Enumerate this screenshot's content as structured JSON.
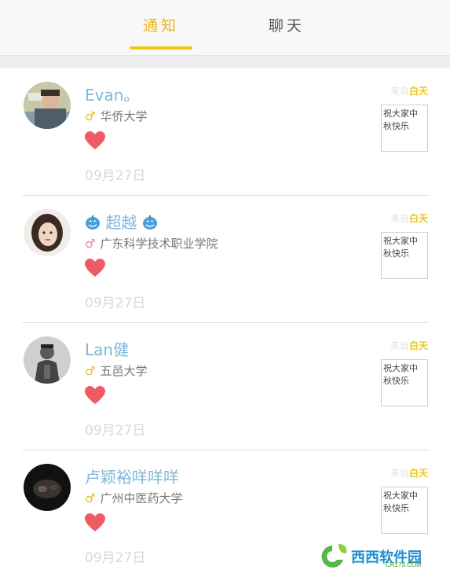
{
  "tabs": [
    {
      "label": "通知",
      "active": true
    },
    {
      "label": "聊天",
      "active": false
    }
  ],
  "notifications": [
    {
      "name": "Evan。",
      "gender": "male",
      "gender_symbol": "♂",
      "school": "华侨大学",
      "date": "09月27日",
      "from_prefix": "来自",
      "from_who": "白天",
      "message": "祝大家中秋快乐"
    },
    {
      "name": "超越",
      "name_decor": "pumpkin-icon",
      "gender": "female",
      "gender_symbol": "♂",
      "school": "广东科学技术职业学院",
      "date": "09月27日",
      "from_prefix": "来自",
      "from_who": "白天",
      "message": "祝大家中秋快乐"
    },
    {
      "name": "Lan健",
      "gender": "male",
      "gender_symbol": "♂",
      "school": "五邑大学",
      "date": "09月27日",
      "from_prefix": "来自",
      "from_who": "白天",
      "message": "祝大家中秋快乐"
    },
    {
      "name": "卢颖裕咩咩咩",
      "gender": "male",
      "gender_symbol": "♂",
      "school": "广州中医药大学",
      "date": "09月27日",
      "from_prefix": "来自",
      "from_who": "白天",
      "message": "祝大家中秋快乐"
    }
  ],
  "watermark": {
    "text": "西西软件园",
    "sub": "CR173.COM"
  },
  "colors": {
    "accent": "#f0c419",
    "name": "#7fb7da",
    "heart": "#ef5b63"
  }
}
